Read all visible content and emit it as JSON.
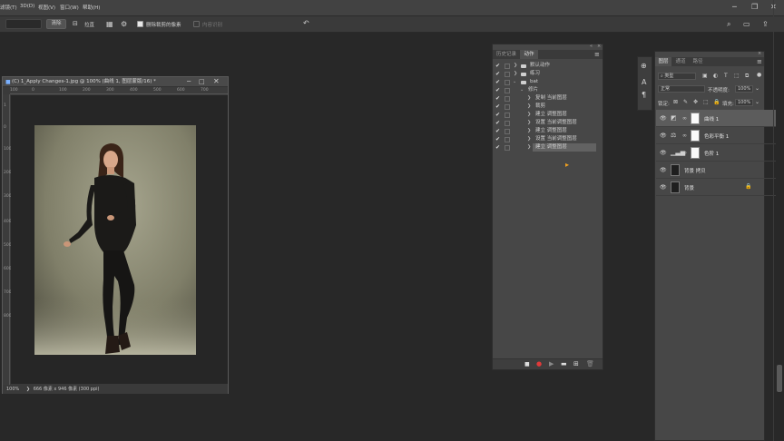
{
  "menu": {
    "items": [
      "滤镜(T)",
      "3D(D)",
      "视图(V)",
      "窗口(W)",
      "帮助(H)"
    ]
  },
  "options": {
    "clear_label": "清除",
    "straighten_label": "拉直",
    "delete_cropped_label": "删除裁剪的像素",
    "content_aware_label": "内容识别"
  },
  "document": {
    "title": "(C) 1_Apply Changes-1.jpg @ 100% (曲线 1, 图层蒙版/16) *",
    "ruler_h": [
      "100",
      "0",
      "100",
      "200",
      "300",
      "400",
      "500",
      "600",
      "700",
      "800"
    ],
    "ruler_v": [
      "1",
      "0",
      "1",
      "100",
      "2",
      "200",
      "3",
      "300",
      "4",
      "400",
      "5",
      "500",
      "6",
      "600",
      "7",
      "700",
      "8",
      "800"
    ],
    "zoom": "100%",
    "status": "666 像素 x 946 像素 (300 ppi)"
  },
  "actions_panel": {
    "tabs": [
      "历史记录",
      "动作"
    ],
    "rows": [
      {
        "label": "默认动作",
        "kind": "set",
        "level": 0
      },
      {
        "label": "练习",
        "kind": "set",
        "level": 0
      },
      {
        "label": "bat",
        "kind": "set",
        "level": 0,
        "open": true
      },
      {
        "label": "修片",
        "kind": "action",
        "level": 1,
        "open": true
      },
      {
        "label": "复制 当前图层",
        "kind": "step",
        "level": 2
      },
      {
        "label": "裁剪",
        "kind": "step",
        "level": 2
      },
      {
        "label": "建立 调整图层",
        "kind": "step",
        "level": 2
      },
      {
        "label": "设置 当前调整图层",
        "kind": "step",
        "level": 2
      },
      {
        "label": "建立 调整图层",
        "kind": "step",
        "level": 2
      },
      {
        "label": "设置 当前调整图层",
        "kind": "step",
        "level": 2
      },
      {
        "label": "建立 调整图层",
        "kind": "step",
        "level": 2,
        "selected": true
      }
    ]
  },
  "layers_panel": {
    "tabs": [
      "图层",
      "通道",
      "路径"
    ],
    "filter_label": "类型",
    "blend_mode": "正常",
    "opacity_label": "不透明度:",
    "opacity_value": "100%",
    "lock_label": "锁定:",
    "fill_label": "填充:",
    "fill_value": "100%",
    "layers": [
      {
        "name": "曲线 1",
        "type": "adjustment",
        "icon": "curves-icon",
        "selected": true
      },
      {
        "name": "色彩平衡 1",
        "type": "adjustment",
        "icon": "balance-icon"
      },
      {
        "name": "色阶 1",
        "type": "adjustment",
        "icon": "levels-icon"
      },
      {
        "name": "背景 拷贝",
        "type": "pixel"
      },
      {
        "name": "背景",
        "type": "pixel",
        "locked": true
      }
    ]
  },
  "colors": {
    "accent": "#1473e6",
    "record": "#e03a3a",
    "cursor": "#f0a020"
  }
}
